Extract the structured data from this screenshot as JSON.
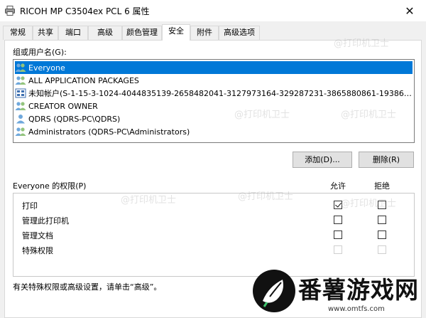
{
  "window": {
    "title": "RICOH MP C3504ex PCL 6 属性",
    "close_glyph": "✕"
  },
  "tabs": [
    {
      "label": "常规"
    },
    {
      "label": "共享"
    },
    {
      "label": "端口"
    },
    {
      "label": "高级"
    },
    {
      "label": "颜色管理"
    },
    {
      "label": "安全",
      "active": true
    },
    {
      "label": "附件"
    },
    {
      "label": "高级选项"
    }
  ],
  "security": {
    "group_label": "组或用户名(G):",
    "users": [
      {
        "name": "Everyone",
        "icon": "users-group-icon",
        "selected": true
      },
      {
        "name": "ALL APPLICATION PACKAGES",
        "icon": "users-group-icon"
      },
      {
        "name": "未知帐户(S-1-15-3-1024-4044835139-2658482041-3127973164-329287231-3865880861-1938685643-46...",
        "icon": "unknown-account-icon"
      },
      {
        "name": "CREATOR OWNER",
        "icon": "users-group-icon"
      },
      {
        "name": "QDRS (QDRS-PC\\QDRS)",
        "icon": "user-icon"
      },
      {
        "name": "Administrators (QDRS-PC\\Administrators)",
        "icon": "users-group-icon"
      }
    ],
    "add_button": "添加(D)...",
    "remove_button": "删除(R)",
    "perm_label": "Everyone 的权限(P)",
    "allow_header": "允许",
    "deny_header": "拒绝",
    "permissions": [
      {
        "name": "打印",
        "allow": true,
        "deny": false,
        "disabled": false
      },
      {
        "name": "管理此打印机",
        "allow": false,
        "deny": false,
        "disabled": false
      },
      {
        "name": "管理文档",
        "allow": false,
        "deny": false,
        "disabled": false
      },
      {
        "name": "特殊权限",
        "allow": false,
        "deny": false,
        "disabled": true
      }
    ],
    "hint": "有关特殊权限或高级设置，请单击“高级”。"
  },
  "watermark": {
    "text": "@打印机卫士",
    "logo_text": "番薯游戏网",
    "logo_url": "www.omtfs.com"
  }
}
